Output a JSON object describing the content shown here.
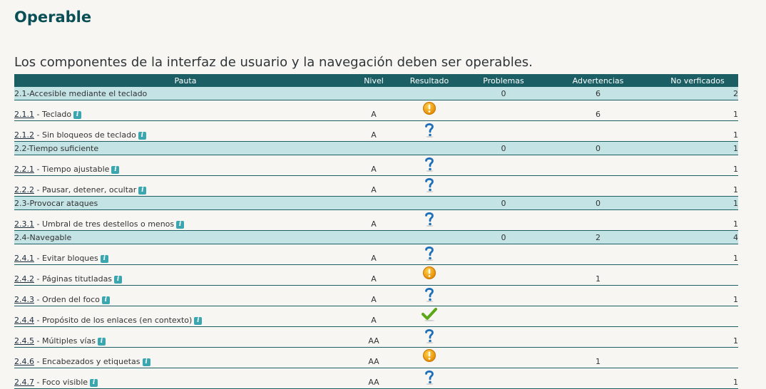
{
  "page": {
    "title": "Operable",
    "subtitle": "Los componentes de la interfaz de usuario y la navegación deben ser operables."
  },
  "table": {
    "headers": {
      "pauta": "Pauta",
      "nivel": "Nivel",
      "resultado": "Resultado",
      "problemas": "Problemas",
      "advertencias": "Advertencias",
      "no_verificados": "No verficados"
    },
    "rows": [
      {
        "type": "group",
        "label": "2.1-Accesible mediante el teclado",
        "problemas": "0",
        "advertencias": "6",
        "no_verificados": "2"
      },
      {
        "type": "item",
        "code": "2.1.1",
        "name": " - Teclado",
        "nivel": "A",
        "resultado": "warning-icon",
        "problemas": "",
        "advertencias": "6",
        "no_verificados": "1"
      },
      {
        "type": "item",
        "code": "2.1.2",
        "name": " - Sin bloqueos de teclado",
        "nivel": "A",
        "resultado": "question-icon",
        "problemas": "",
        "advertencias": "",
        "no_verificados": "1"
      },
      {
        "type": "group",
        "label": "2.2-Tiempo suficiente",
        "problemas": "0",
        "advertencias": "0",
        "no_verificados": "1"
      },
      {
        "type": "item",
        "code": "2.2.1",
        "name": " - Tiempo ajustable",
        "nivel": "A",
        "resultado": "question-icon",
        "problemas": "",
        "advertencias": "",
        "no_verificados": "1"
      },
      {
        "type": "item",
        "code": "2.2.2",
        "name": " - Pausar, detener, ocultar",
        "nivel": "A",
        "resultado": "question-icon",
        "problemas": "",
        "advertencias": "",
        "no_verificados": "1"
      },
      {
        "type": "group",
        "label": "2.3-Provocar ataques",
        "problemas": "0",
        "advertencias": "0",
        "no_verificados": "1"
      },
      {
        "type": "item",
        "code": "2.3.1",
        "name": " - Umbral de tres destellos o menos",
        "nivel": "A",
        "resultado": "question-icon",
        "problemas": "",
        "advertencias": "",
        "no_verificados": "1"
      },
      {
        "type": "group",
        "label": "2.4-Navegable",
        "problemas": "0",
        "advertencias": "2",
        "no_verificados": "4"
      },
      {
        "type": "item",
        "code": "2.4.1",
        "name": " - Evitar bloques",
        "nivel": "A",
        "resultado": "question-icon",
        "problemas": "",
        "advertencias": "",
        "no_verificados": "1"
      },
      {
        "type": "item",
        "code": "2.4.2",
        "name": " - Páginas titutladas",
        "nivel": "A",
        "resultado": "warning-icon",
        "problemas": "",
        "advertencias": "1",
        "no_verificados": ""
      },
      {
        "type": "item",
        "code": "2.4.3",
        "name": " - Orden del foco",
        "nivel": "A",
        "resultado": "question-icon",
        "problemas": "",
        "advertencias": "",
        "no_verificados": "1"
      },
      {
        "type": "item",
        "code": "2.4.4",
        "name": " - Propósito de los enlaces (en contexto)",
        "nivel": "A",
        "resultado": "check-icon",
        "problemas": "",
        "advertencias": "",
        "no_verificados": ""
      },
      {
        "type": "item",
        "code": "2.4.5",
        "name": " - Múltiples vías",
        "nivel": "AA",
        "resultado": "question-icon",
        "problemas": "",
        "advertencias": "",
        "no_verificados": "1"
      },
      {
        "type": "item",
        "code": "2.4.6",
        "name": " - Encabezados y etiquetas",
        "nivel": "AA",
        "resultado": "warning-icon",
        "problemas": "",
        "advertencias": "1",
        "no_verificados": ""
      },
      {
        "type": "item",
        "code": "2.4.7",
        "name": " - Foco visible",
        "nivel": "AA",
        "resultado": "question-icon",
        "problemas": "",
        "advertencias": "",
        "no_verificados": "1"
      }
    ]
  },
  "info_glyph": "i",
  "colors": {
    "accent": "#1b5f65",
    "group_row": "#c4e3e5",
    "title": "#0b4f56",
    "info_icon": "#3aa7b0",
    "warning": "#f0a000",
    "question": "#1d6fb8",
    "check": "#5aa818"
  }
}
